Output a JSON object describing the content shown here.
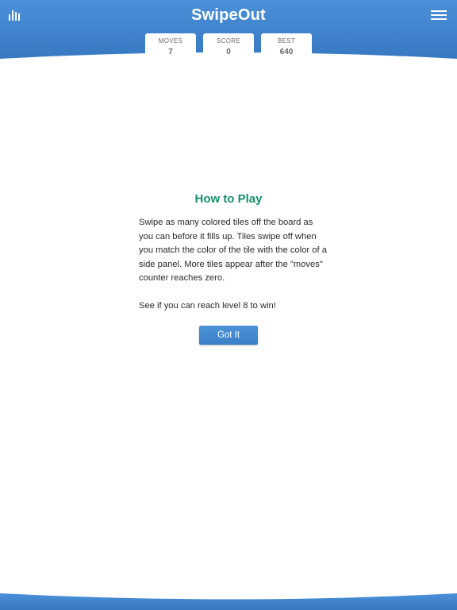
{
  "header": {
    "title": "SwipeOut",
    "left_icon": "bar-chart-icon",
    "right_icon": "hamburger-menu-icon"
  },
  "stats": [
    {
      "label": "MOVES",
      "value": "7"
    },
    {
      "label": "SCORE",
      "value": "0"
    },
    {
      "label": "BEST",
      "value": "640"
    }
  ],
  "howto": {
    "title": "How to Play",
    "body": "Swipe as many colored tiles off the board as you can before it fills up. Tiles swipe off when you match the color of the tile with the color of a side panel. More tiles appear after the \"moves\" counter reaches zero.",
    "goal": "See if you can reach level 8 to win!",
    "button_label": "Got It"
  },
  "colors": {
    "header_blue": "#3d85cc",
    "title_green": "#17906a",
    "button_blue": "#4289d0"
  }
}
